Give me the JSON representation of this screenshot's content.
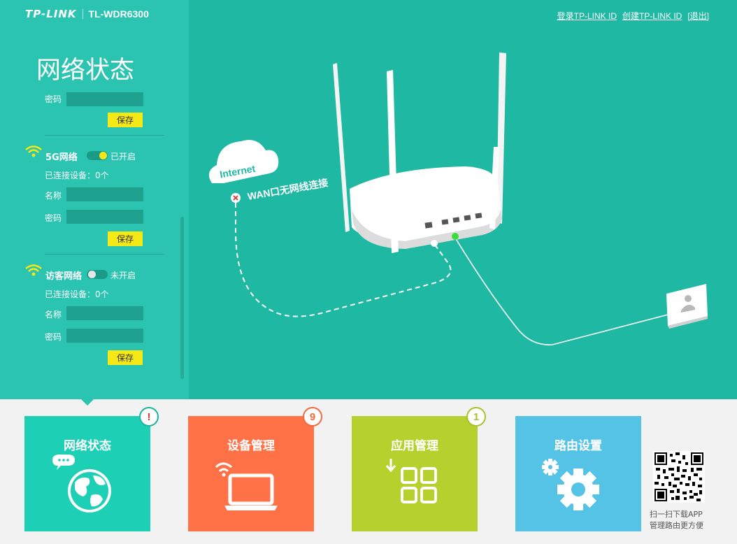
{
  "header": {
    "brand": "TP-LINK",
    "model": "TL-WDR6300",
    "links": [
      "登录TP-LINK ID",
      "创建TP-LINK ID",
      "[退出]"
    ]
  },
  "panel": {
    "title": "网络状态",
    "top_password_label": "密码",
    "save_label": "保存",
    "wifi5g": {
      "title": "5G网络",
      "status": "已开启",
      "connected": "已连接设备：0个",
      "name_label": "名称",
      "password_label": "密码",
      "save_label": "保存"
    },
    "guest": {
      "title": "访客网络",
      "status": "未开启",
      "connected": "已连接设备：0个",
      "name_label": "名称",
      "password_label": "密码",
      "save_label": "保存"
    }
  },
  "scene": {
    "internet_label": "Internet",
    "wan_status": "WAN口无网线连接"
  },
  "tiles": [
    {
      "title": "网络状态",
      "badge": "!",
      "color": "#1ccfb5",
      "badge_color": "#1ab59f"
    },
    {
      "title": "设备管理",
      "badge": "9",
      "color": "#ff7146",
      "badge_color": "#f26a3e"
    },
    {
      "title": "应用管理",
      "badge": "1",
      "color": "#b6d12e",
      "badge_color": "#a8c22a"
    },
    {
      "title": "路由设置",
      "badge": "",
      "color": "#55c3e6",
      "badge_color": "#55c3e6"
    }
  ],
  "qr": {
    "line1": "扫一扫下载APP",
    "line2": "管理路由更方便"
  },
  "colors": {
    "accent_bg": "#1fb8a3",
    "panel_bg": "#2bc4b0",
    "save_button": "#f4e916",
    "link_ok": "#3ddc3d",
    "error": "#e0352b"
  }
}
